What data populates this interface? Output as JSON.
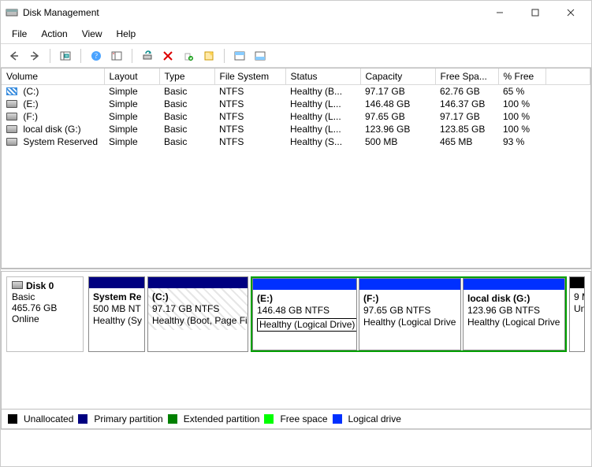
{
  "window": {
    "title": "Disk Management"
  },
  "menubar": {
    "file": "File",
    "action": "Action",
    "view": "View",
    "help": "Help"
  },
  "columns": {
    "volume": "Volume",
    "layout": "Layout",
    "type": "Type",
    "filesystem": "File System",
    "status": "Status",
    "capacity": "Capacity",
    "freespace": "Free Spa...",
    "pctfree": "% Free"
  },
  "volumes": [
    {
      "icon": "striped",
      "name": " (C:)",
      "layout": "Simple",
      "type": "Basic",
      "fs": "NTFS",
      "status": "Healthy (B...",
      "capacity": "97.17 GB",
      "free": "62.76 GB",
      "pct": "65 %"
    },
    {
      "icon": "drive",
      "name": " (E:)",
      "layout": "Simple",
      "type": "Basic",
      "fs": "NTFS",
      "status": "Healthy (L...",
      "capacity": "146.48 GB",
      "free": "146.37 GB",
      "pct": "100 %"
    },
    {
      "icon": "drive",
      "name": " (F:)",
      "layout": "Simple",
      "type": "Basic",
      "fs": "NTFS",
      "status": "Healthy (L...",
      "capacity": "97.65 GB",
      "free": "97.17 GB",
      "pct": "100 %"
    },
    {
      "icon": "drive",
      "name": " local disk (G:)",
      "layout": "Simple",
      "type": "Basic",
      "fs": "NTFS",
      "status": "Healthy (L...",
      "capacity": "123.96 GB",
      "free": "123.85 GB",
      "pct": "100 %"
    },
    {
      "icon": "drive",
      "name": " System Reserved",
      "layout": "Simple",
      "type": "Basic",
      "fs": "NTFS",
      "status": "Healthy (S...",
      "capacity": "500 MB",
      "free": "465 MB",
      "pct": "93 %"
    }
  ],
  "disk": {
    "name": "Disk 0",
    "type": "Basic",
    "size": "465.76 GB",
    "state": "Online"
  },
  "partitions": {
    "sysres": {
      "label": "System Re",
      "size": "500 MB NT",
      "status": "Healthy (Sy"
    },
    "c": {
      "label": "(C:)",
      "size": "97.17 GB NTFS",
      "status": "Healthy (Boot, Page Fi"
    },
    "e": {
      "label": "(E:)",
      "size": "146.48 GB NTFS",
      "status": "Healthy (Logical Drive)"
    },
    "f": {
      "label": "(F:)",
      "size": "97.65 GB NTFS",
      "status": "Healthy (Logical Drive"
    },
    "g": {
      "label": "local disk  (G:)",
      "size": "123.96 GB NTFS",
      "status": "Healthy (Logical Drive"
    },
    "unalloc": {
      "label": "",
      "size": "9 M",
      "status": "Un"
    }
  },
  "legend": {
    "unallocated": "Unallocated",
    "primary": "Primary partition",
    "extended": "Extended partition",
    "free": "Free space",
    "logical": "Logical drive"
  }
}
